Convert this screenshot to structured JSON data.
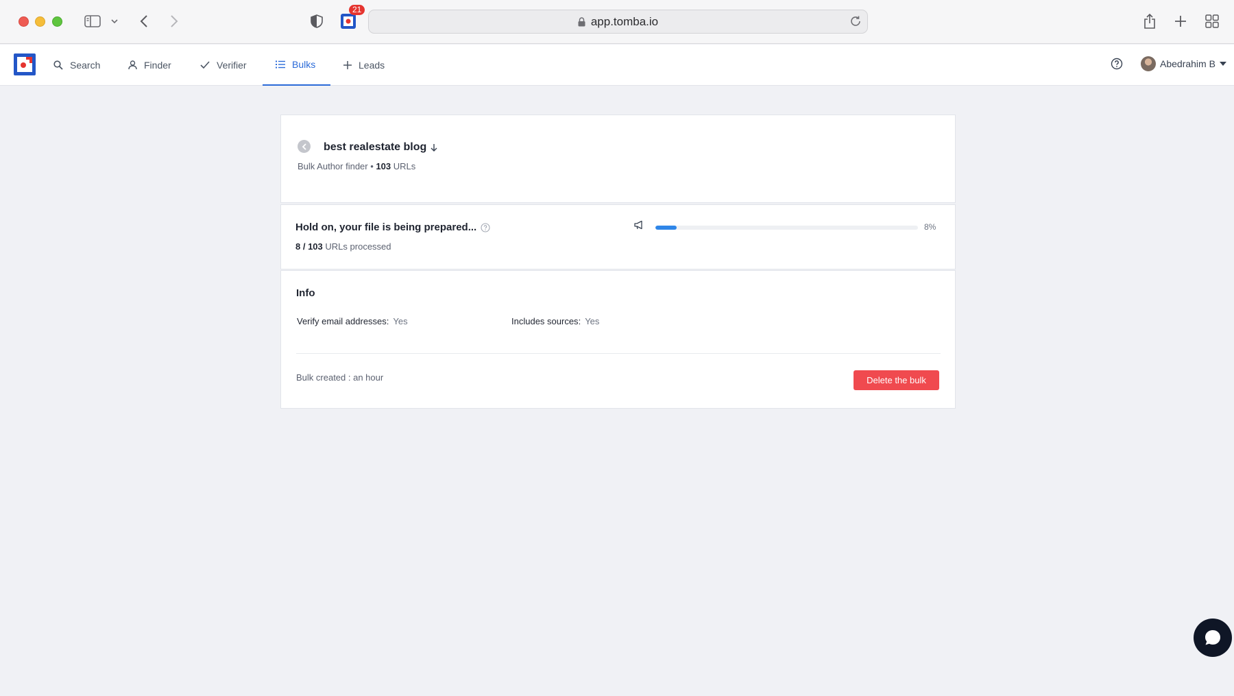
{
  "browser": {
    "url": "app.tomba.io",
    "extension_badge": "21"
  },
  "nav": {
    "items": [
      {
        "label": "Search",
        "icon": "search-icon"
      },
      {
        "label": "Finder",
        "icon": "user-icon"
      },
      {
        "label": "Verifier",
        "icon": "check-icon"
      },
      {
        "label": "Bulks",
        "icon": "list-icon",
        "active": true
      },
      {
        "label": "Leads",
        "icon": "plus-icon"
      }
    ],
    "user_name": "Abedrahim B"
  },
  "bulk": {
    "title": "best realestate blog",
    "type": "Bulk Author finder",
    "url_count": "103",
    "url_unit": "URLs"
  },
  "progress": {
    "title": "Hold on, your file is being prepared...",
    "processed": "8",
    "total": "103",
    "processed_suffix": "URLs processed",
    "percent_label": "8%",
    "percent_value": 8,
    "color": "#2f86e8"
  },
  "info": {
    "title": "Info",
    "verify_label": "Verify email addresses",
    "verify_value": "Yes",
    "sources_label": "Includes sources",
    "sources_value": "Yes",
    "created_text": "Bulk created : an hour",
    "delete_label": "Delete the bulk",
    "delete_color": "#f04a4f"
  }
}
